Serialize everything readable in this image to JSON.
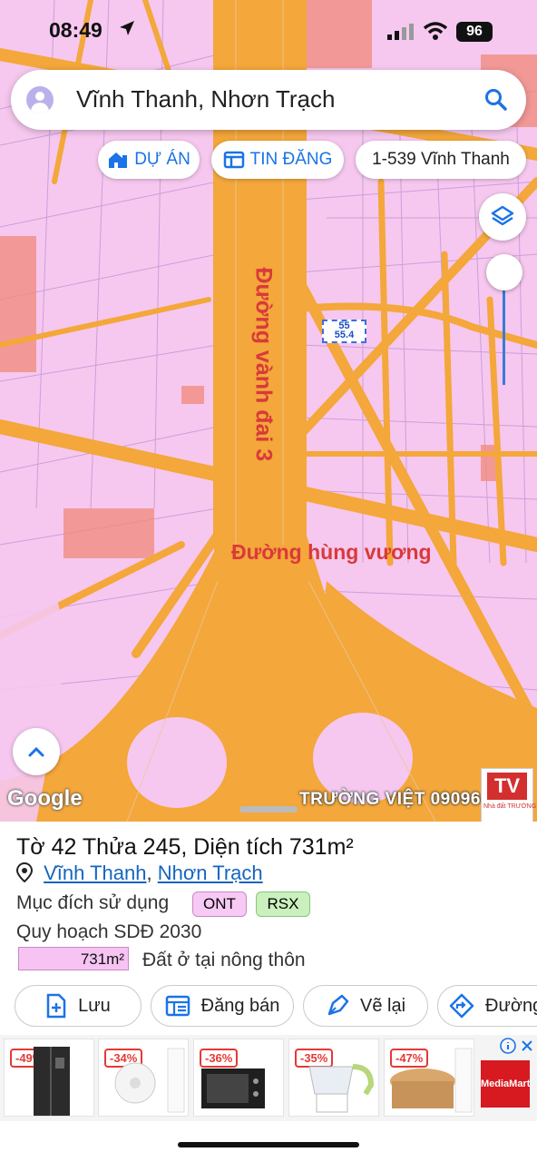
{
  "status": {
    "time": "08:49",
    "battery": "96"
  },
  "search": {
    "query": "Vĩnh Thanh, Nhơn Trạch"
  },
  "chips": {
    "du_an": "DỰ ÁN",
    "tin_dang": "TIN ĐĂNG",
    "address": "1-539 Vĩnh Thanh"
  },
  "map": {
    "road_label_vertical": "Đường vành đai 3",
    "road_label_horizontal": "Đường hùng vương",
    "parcel_label_line1": "55",
    "parcel_label_line2": "55.4",
    "google_logo": "Google",
    "watermark": "TRƯỜNG VIỆT 090966",
    "tv_logo": "TV",
    "tv_sub": "Nhà đất TRƯỜNG"
  },
  "parcel": {
    "title": "Tờ 42 Thửa 245, Diện tích 731m²",
    "commune": "Vĩnh Thanh",
    "separator": ",",
    "district": "Nhơn Trạch",
    "purpose_label": "Mục đích sử dụng",
    "purpose_tags": [
      "ONT",
      "RSX"
    ],
    "planning_label": "Quy hoạch SDĐ 2030",
    "planning_area": "731m²",
    "planning_type": "Đất ở tại nông thôn"
  },
  "actions": {
    "save": "Lưu",
    "sell": "Đăng bán",
    "redraw": "Vẽ lại",
    "directions": "Đường"
  },
  "ads": [
    "-49%",
    "-34%",
    "-36%",
    "-35%",
    "-47%"
  ],
  "colors": {
    "road": "#f4a73a",
    "land": "#f6c8ef",
    "accent": "#1a73e8",
    "label_red": "#d93a3a"
  }
}
